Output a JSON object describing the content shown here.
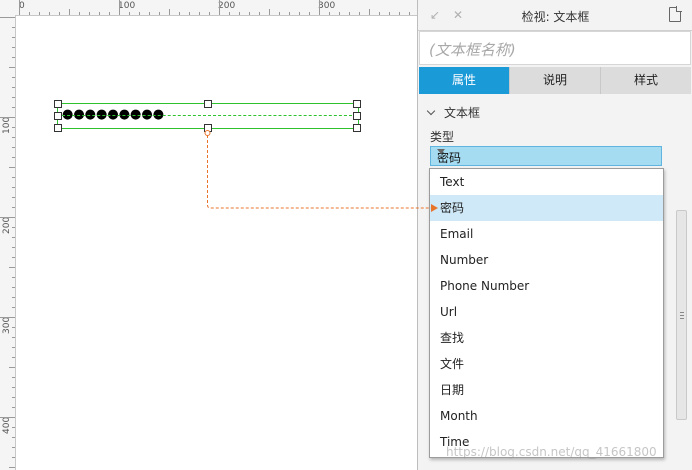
{
  "ruler": {
    "top_labels": [
      "0",
      "100",
      "200",
      "300"
    ],
    "left_labels": [
      "100",
      "200",
      "300",
      "400"
    ]
  },
  "canvas": {
    "password_value": "●●●●●●●●●"
  },
  "inspector": {
    "title": "检视: 文本框",
    "name_placeholder": "(文本框名称)",
    "tabs": [
      {
        "label": "属性",
        "active": true
      },
      {
        "label": "说明",
        "active": false
      },
      {
        "label": "样式",
        "active": false
      }
    ],
    "section_title": "文本框",
    "type_label": "类型",
    "type_selected": "密码"
  },
  "dropdown": {
    "items": [
      "Text",
      "密码",
      "Email",
      "Number",
      "Phone Number",
      "Url",
      "查找",
      "文件",
      "日期",
      "Month",
      "Time"
    ],
    "selected_index": 1
  },
  "watermark": "https://blog.csdn.net/qq_41661800",
  "colors": {
    "accent": "#1b9ad8",
    "selection_green": "#2ec32e",
    "connector_orange": "#e8742c",
    "select_bg": "#a6dcf2",
    "item_highlight": "#cfe9f8"
  }
}
